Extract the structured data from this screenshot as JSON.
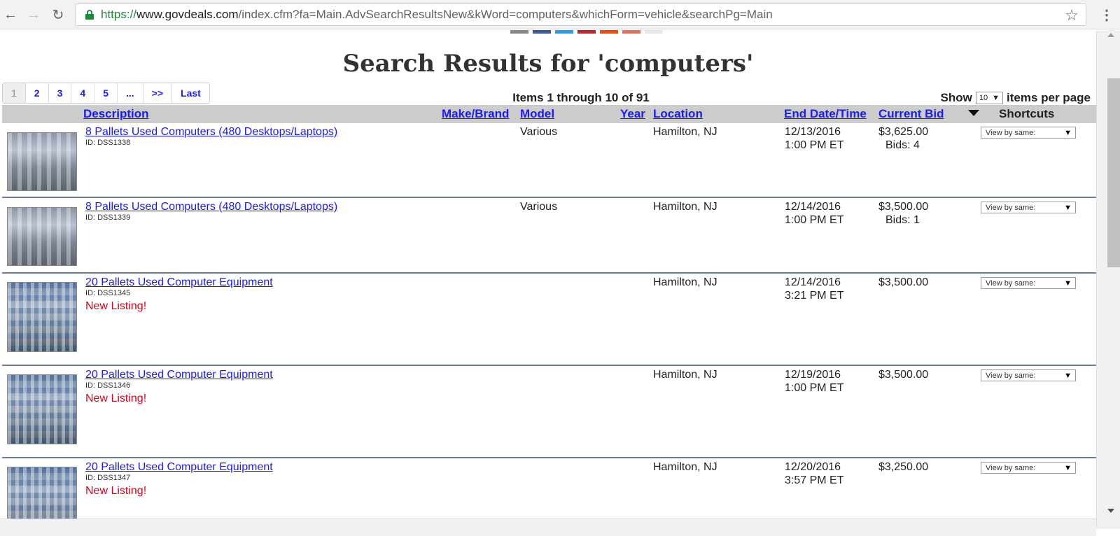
{
  "browser": {
    "url_scheme": "https://",
    "url_host": "www.govdeals.com",
    "url_path": "/index.cfm?fa=Main.AdvSearchResultsNew&kWord=computers&whichForm=vehicle&searchPg=Main",
    "back_icon": "←",
    "forward_icon": "→",
    "reload_icon": "↻",
    "star_icon": "☆",
    "menu_icon": "⋮"
  },
  "social_colors": [
    "#888888",
    "#3b5998",
    "#1da1f2",
    "#cb2027",
    "#ff4500",
    "#ee6c5a",
    "#e8e8e8"
  ],
  "page": {
    "title": "Search Results for 'computers'"
  },
  "pager": {
    "pages": [
      "1",
      "2",
      "3",
      "4",
      "5",
      "...",
      ">>",
      "Last"
    ]
  },
  "summary": {
    "items_text": "Items 1 through 10 of 91",
    "show_label": "Show",
    "per_page_value": "10",
    "per_page_label": "items per page"
  },
  "table": {
    "headers": {
      "description": "Description",
      "make": "Make/Brand",
      "model": "Model",
      "year": "Year",
      "location": "Location",
      "end": "End Date/Time",
      "bid": "Current Bid",
      "shortcuts": "Shortcuts"
    },
    "rows": [
      {
        "description": "8 Pallets Used Computers (480 Desktops/Laptops)",
        "id": "ID: DSS1338",
        "new_listing": "",
        "model": "Various",
        "location": "Hamilton, NJ",
        "end_date": "12/13/2016",
        "end_time": "1:00 PM ET",
        "bid": "$3,625.00",
        "bids": "Bids: 4",
        "shortcut": "View by same:"
      },
      {
        "description": "8 Pallets Used Computers (480 Desktops/Laptops)",
        "id": "ID: DSS1339",
        "new_listing": "",
        "model": "Various",
        "location": "Hamilton, NJ",
        "end_date": "12/14/2016",
        "end_time": "1:00 PM ET",
        "bid": "$3,500.00",
        "bids": "Bids: 1",
        "shortcut": "View by same:"
      },
      {
        "description": "20 Pallets Used Computer Equipment",
        "id": "ID: DSS1345",
        "new_listing": "New Listing!",
        "model": "",
        "location": "Hamilton, NJ",
        "end_date": "12/14/2016",
        "end_time": "3:21 PM ET",
        "bid": "$3,500.00",
        "bids": "",
        "shortcut": "View by same:"
      },
      {
        "description": "20 Pallets Used Computer Equipment",
        "id": "ID: DSS1346",
        "new_listing": "New Listing!",
        "model": "",
        "location": "Hamilton, NJ",
        "end_date": "12/19/2016",
        "end_time": "1:00 PM ET",
        "bid": "$3,500.00",
        "bids": "",
        "shortcut": "View by same:"
      },
      {
        "description": "20 Pallets Used Computer Equipment",
        "id": "ID: DSS1347",
        "new_listing": "New Listing!",
        "model": "",
        "location": "Hamilton, NJ",
        "end_date": "12/20/2016",
        "end_time": "3:57 PM ET",
        "bid": "$3,250.00",
        "bids": "",
        "shortcut": "View by same:"
      }
    ]
  }
}
